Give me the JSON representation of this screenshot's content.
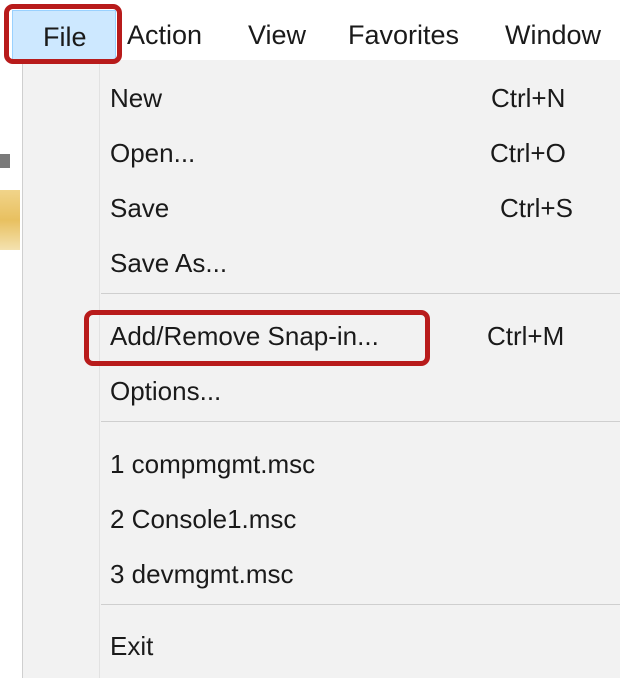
{
  "menubar": {
    "items": [
      {
        "label": "File",
        "active": true
      },
      {
        "label": "Action"
      },
      {
        "label": "View"
      },
      {
        "label": "Favorites"
      },
      {
        "label": "Window"
      }
    ]
  },
  "file_menu": {
    "items": [
      {
        "label": "New",
        "shortcut": "Ctrl+N"
      },
      {
        "label": "Open...",
        "shortcut": "Ctrl+O"
      },
      {
        "label": "Save",
        "shortcut": "Ctrl+S"
      },
      {
        "label": "Save As...",
        "shortcut": ""
      },
      {
        "label": "Add/Remove Snap-in...",
        "shortcut": "Ctrl+M",
        "highlighted": true
      },
      {
        "label": "Options...",
        "shortcut": ""
      },
      {
        "label": "1 compmgmt.msc",
        "shortcut": ""
      },
      {
        "label": "2 Console1.msc",
        "shortcut": ""
      },
      {
        "label": "3 devmgmt.msc",
        "shortcut": ""
      },
      {
        "label": "Exit",
        "shortcut": ""
      }
    ]
  },
  "colors": {
    "highlight_box": "#b81b1b",
    "active_menu_bg": "#cde8ff",
    "menu_bg": "#f2f2f2",
    "separator": "#cfcfcf"
  }
}
